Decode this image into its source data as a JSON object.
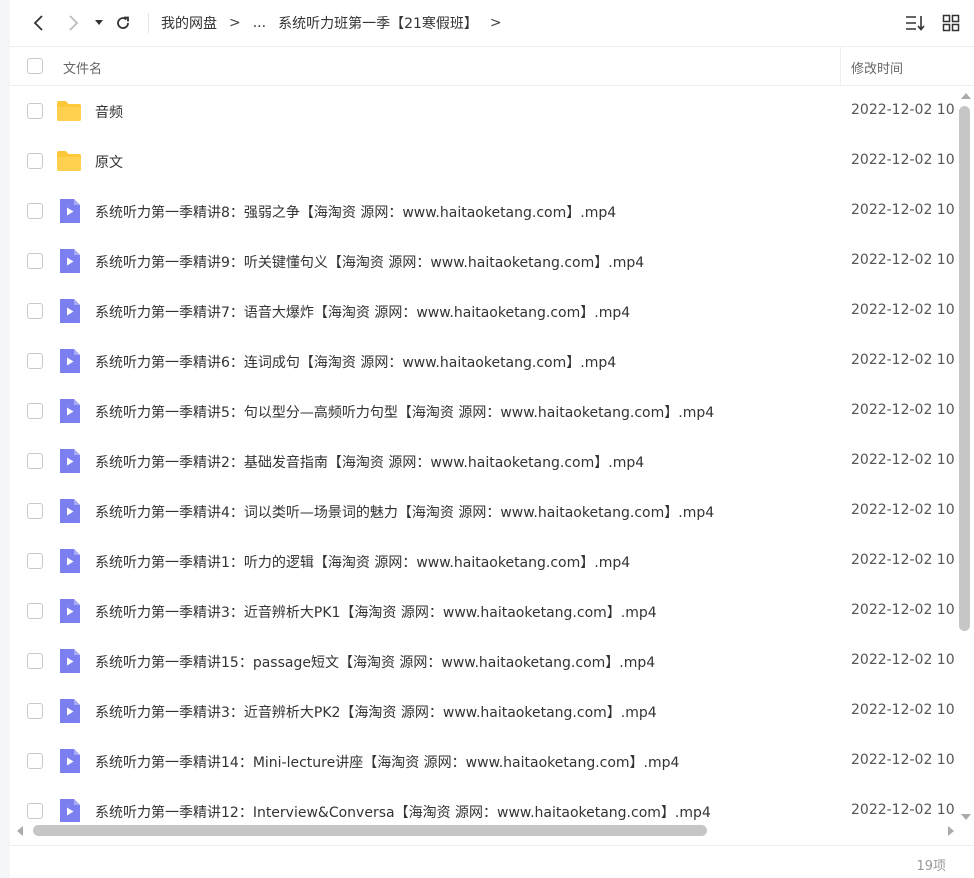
{
  "toolbar": {
    "breadcrumb": [
      "我的网盘",
      "...",
      "系统听力班第一季【21寒假班】"
    ],
    "separator": ">"
  },
  "header": {
    "name_label": "文件名",
    "time_label": "修改时间"
  },
  "files": [
    {
      "type": "folder",
      "name": "音频",
      "time": "2022-12-02 10"
    },
    {
      "type": "folder",
      "name": "原文",
      "time": "2022-12-02 10"
    },
    {
      "type": "video",
      "name": "系统听力第一季精讲8：强弱之争【海淘资 源网：www.haitaoketang.com】.mp4",
      "time": "2022-12-02 10"
    },
    {
      "type": "video",
      "name": "系统听力第一季精讲9：听关键懂句义【海淘资 源网：www.haitaoketang.com】.mp4",
      "time": "2022-12-02 10"
    },
    {
      "type": "video",
      "name": "系统听力第一季精讲7：语音大爆炸【海淘资 源网：www.haitaoketang.com】.mp4",
      "time": "2022-12-02 10"
    },
    {
      "type": "video",
      "name": "系统听力第一季精讲6：连词成句【海淘资 源网：www.haitaoketang.com】.mp4",
      "time": "2022-12-02 10"
    },
    {
      "type": "video",
      "name": "系统听力第一季精讲5：句以型分—高频听力句型【海淘资 源网：www.haitaoketang.com】.mp4",
      "time": "2022-12-02 10"
    },
    {
      "type": "video",
      "name": "系统听力第一季精讲2：基础发音指南【海淘资 源网：www.haitaoketang.com】.mp4",
      "time": "2022-12-02 10"
    },
    {
      "type": "video",
      "name": "系统听力第一季精讲4：词以类听—场景词的魅力【海淘资 源网：www.haitaoketang.com】.mp4",
      "time": "2022-12-02 10"
    },
    {
      "type": "video",
      "name": "系统听力第一季精讲1：听力的逻辑【海淘资 源网：www.haitaoketang.com】.mp4",
      "time": "2022-12-02 10"
    },
    {
      "type": "video",
      "name": "系统听力第一季精讲3：近音辨析大PK1【海淘资 源网：www.haitaoketang.com】.mp4",
      "time": "2022-12-02 10"
    },
    {
      "type": "video",
      "name": "系统听力第一季精讲15：passage短文【海淘资 源网：www.haitaoketang.com】.mp4",
      "time": "2022-12-02 10"
    },
    {
      "type": "video",
      "name": "系统听力第一季精讲3：近音辨析大PK2【海淘资 源网：www.haitaoketang.com】.mp4",
      "time": "2022-12-02 10"
    },
    {
      "type": "video",
      "name": "系统听力第一季精讲14：Mini-lecture讲座【海淘资 源网：www.haitaoketang.com】.mp4",
      "time": "2022-12-02 10"
    },
    {
      "type": "video",
      "name": "系统听力第一季精讲12：Interview&Conversa【海淘资 源网：www.haitaoketang.com】.mp4",
      "time": "2022-12-02 10"
    }
  ],
  "footer": {
    "count": "19项"
  },
  "colors": {
    "folder": "#ffc73a",
    "video": "#7b7ff0",
    "border": "#eeeeee"
  }
}
